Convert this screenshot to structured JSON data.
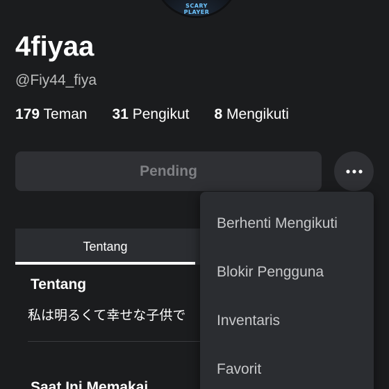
{
  "profile": {
    "avatar_text": "SCARY\nPLAYER",
    "display_name": "4fiyaa",
    "username": "@Fiy44_fiya"
  },
  "stats": {
    "friends_count": "179",
    "friends_label": "Teman",
    "followers_count": "31",
    "followers_label": "Pengikut",
    "following_count": "8",
    "following_label": "Mengikuti"
  },
  "actions": {
    "pending_label": "Pending",
    "more_icon": "ellipsis-icon"
  },
  "tabs": {
    "about_label": "Tentang"
  },
  "about": {
    "title": "Tentang",
    "text": "私は明るくて幸せな子供で",
    "currently_wearing_title": "Saat Ini Memakai"
  },
  "menu": {
    "items": [
      {
        "label": "Berhenti Mengikuti"
      },
      {
        "label": "Blokir Pengguna"
      },
      {
        "label": "Inventaris"
      },
      {
        "label": "Favorit"
      }
    ]
  },
  "colors": {
    "background": "#1b1c1e",
    "surface": "#2f3034",
    "menu_bg": "#2b2d31",
    "muted_text": "#bdbebe"
  }
}
